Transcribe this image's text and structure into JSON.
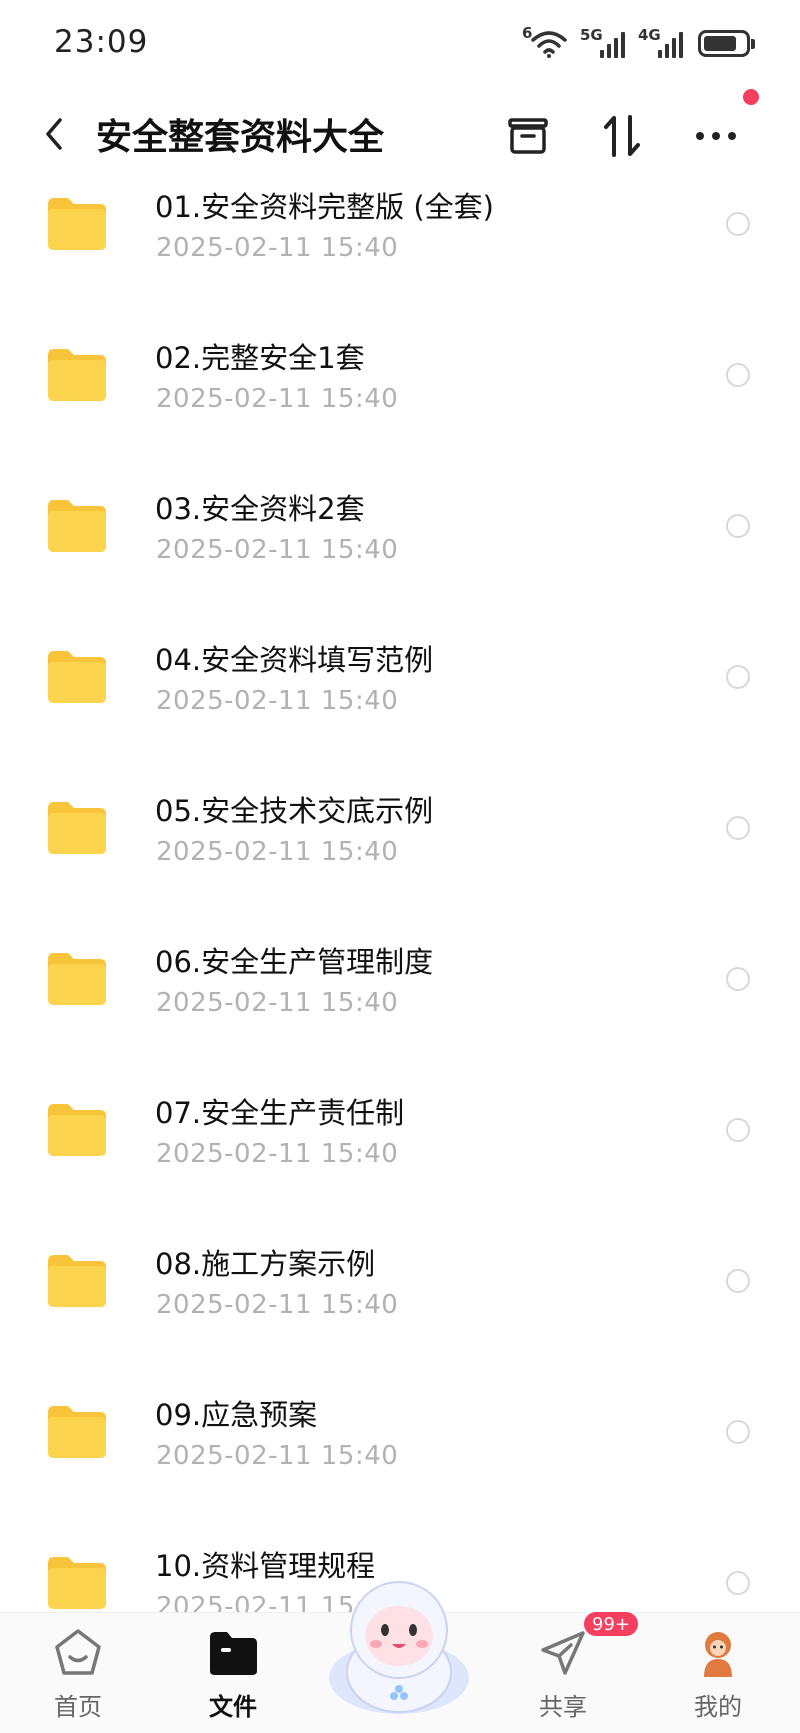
{
  "status_bar": {
    "time": "23:09",
    "network_1": "5G",
    "network_2": "4G",
    "wifi_label": "6"
  },
  "header": {
    "title": "安全整套资料大全",
    "back_icon": "chevron-left-icon",
    "archive_icon": "archive-box-icon",
    "sort_icon": "sort-arrows-icon",
    "more_icon": "more-dots-icon",
    "notification_dot_color": "#f43f5e"
  },
  "files": [
    {
      "name": "01.安全资料完整版 (全套)",
      "date": "2025-02-11  15:40"
    },
    {
      "name": "02.完整安全1套",
      "date": "2025-02-11  15:40"
    },
    {
      "name": "03.安全资料2套",
      "date": "2025-02-11  15:40"
    },
    {
      "name": "04.安全资料填写范例",
      "date": "2025-02-11  15:40"
    },
    {
      "name": "05.安全技术交底示例",
      "date": "2025-02-11  15:40"
    },
    {
      "name": "06.安全生产管理制度",
      "date": "2025-02-11  15:40"
    },
    {
      "name": "07.安全生产责任制",
      "date": "2025-02-11  15:40"
    },
    {
      "name": "08.施工方案示例",
      "date": "2025-02-11  15:40"
    },
    {
      "name": "09.应急预案",
      "date": "2025-02-11  15:40"
    },
    {
      "name": "10.资料管理规程",
      "date": "2025-02-11  15:40"
    }
  ],
  "tab_bar": {
    "home": "首页",
    "files": "文件",
    "share": "共享",
    "share_badge": "99+",
    "mine": "我的"
  },
  "colors": {
    "folder": "#fcd34d",
    "folder_tab": "#f8c53a",
    "badge": "#f43f5e",
    "date_text": "#b1b1b6"
  }
}
